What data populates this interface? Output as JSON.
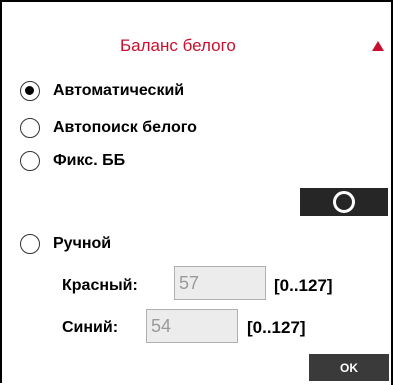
{
  "panel": {
    "title": "Баланс белого",
    "collapse_icon": "triangle-up-icon",
    "accent_color": "#c8102e"
  },
  "modes": [
    {
      "label": "Автоматический",
      "selected": true
    },
    {
      "label": "Автопоиск белого",
      "selected": false
    },
    {
      "label": "Фикс. ББ",
      "selected": false
    },
    {
      "label": "Ручной",
      "selected": false
    }
  ],
  "fix_button": {
    "icon": "circle-icon"
  },
  "manual": {
    "red": {
      "label": "Красный:",
      "value": "57",
      "range": "[0..127]"
    },
    "blue": {
      "label": "Синий:",
      "value": "54",
      "range": "[0..127]"
    }
  },
  "ok_label": "OK"
}
